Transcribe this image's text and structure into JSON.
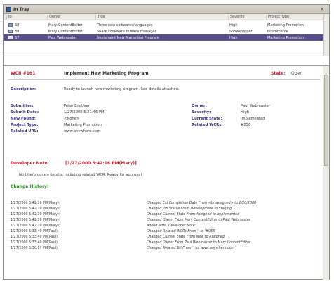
{
  "window": {
    "title": "In Tray",
    "close_glyph": "×"
  },
  "grid": {
    "columns": [
      "Id",
      "Owner",
      "Title",
      "Severity",
      "Project Type"
    ],
    "rows": [
      {
        "id": "68",
        "owner": "Mary ContentEditor",
        "title": "Three new softwares/languages",
        "severity": "High",
        "type": "Marketing Promotion",
        "selected": false
      },
      {
        "id": "88",
        "owner": "Mary ContentEditor",
        "title": "Shark cookware threads manager",
        "severity": "Showstopper",
        "type": "Ecommerce",
        "selected": false
      },
      {
        "id": "57",
        "owner": "Paul Webmaster",
        "title": "Implement New Marketing Program",
        "severity": "High",
        "type": "Marketing Promotion",
        "selected": true
      }
    ]
  },
  "detail": {
    "wr_id": "WCR #161",
    "title": "Implement New Marketing Program",
    "state_label": "State:",
    "state_value": "Open",
    "description_label": "Description:",
    "description_value": "Ready to launch new marketing program. See details attached.",
    "submitter_label": "Submitter:",
    "submitter_value": "Peter EndUser",
    "submit_date_label": "Submit Date:",
    "submit_date_value": "1/27/2000 5:21:46 PM",
    "new_found_label": "New Found:",
    "new_found_value": "<None>",
    "project_type_label": "Project Type:",
    "project_type_value": "Marketing Promotion",
    "related_url_label": "Related URL:",
    "related_url_value": "www.anywhere.com",
    "owner_label": "Owner:",
    "owner_value": "Paul Webmaster",
    "severity_label": "Severity:",
    "severity_value": "High",
    "current_state_label": "Current State:",
    "current_state_value": "Implemented",
    "related_wcrs_label": "Related WCRs:",
    "related_wcrs_value": "#056",
    "dev_note_label": "Developer Note",
    "dev_note_date": "[1/27/2000 5:42:16 PM(Mary)]",
    "dev_note_body": "No title/program details, including related WCR. Ready for approval.",
    "history_label": "Change History:",
    "history": [
      {
        "date": "1/27/2000 5:42:10 PM(Mary):",
        "change": "Changed Est Completion Date From <Unassigned> to 2/20/2000"
      },
      {
        "date": "1/27/2000 5:42:10 PM(Mary):",
        "change": "Changed Job Status From Development to Staging"
      },
      {
        "date": "1/27/2000 5:42:10 PM(Mary):",
        "change": "Changed Current State From Assigned to Implemented"
      },
      {
        "date": "1/27/2000 5:42:10 PM(Mary):",
        "change": "Changed Owner From Mary ContentEditor to Paul Webmaster"
      },
      {
        "date": "1/27/2000 5:42:10 PM(Mary):",
        "change": "Added Note 'Developer Note'"
      },
      {
        "date": "1/27/2000 5:33:40 PM(Paul):",
        "change": "Changed Related WCRs From '' to '#056'"
      },
      {
        "date": "1/27/2000 5:33:40 PM(Paul):",
        "change": "Changed Current State From New to Assigned"
      },
      {
        "date": "1/27/2000 5:33:40 PM(Paul):",
        "change": "Changed Owner From Paul Webmaster to Mary ContentEditor"
      },
      {
        "date": "1/27/2000 5:30:07 PM(Paul):",
        "change": "Changed Related Url From '' to 'www.anywhere.com'"
      }
    ]
  },
  "colors": {
    "selected_row": "#5a4f8a",
    "accent_red": "#c0242f",
    "label_purple": "#3e2e7e",
    "history_green": "#2f8b2a"
  }
}
